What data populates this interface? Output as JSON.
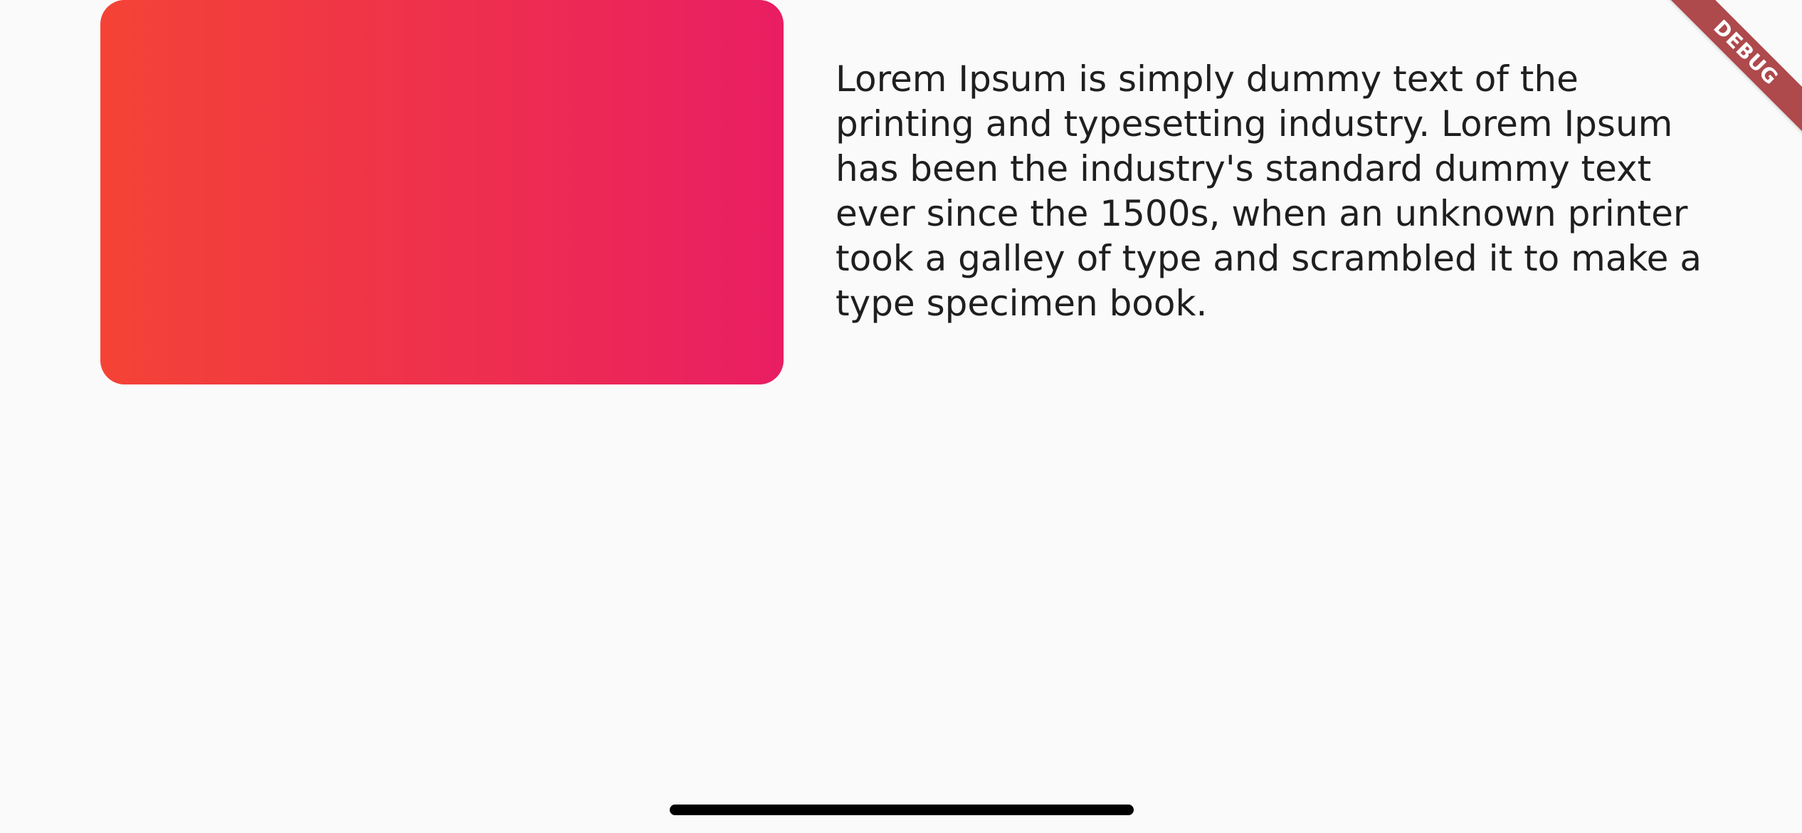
{
  "card": {
    "gradient_start": "#f44336",
    "gradient_end": "#e91e63"
  },
  "content": {
    "text": "Lorem Ipsum is simply dummy text of the printing and typesetting industry. Lorem Ipsum has been the industry's standard dummy text ever since the 1500s, when an unknown printer took a galley of type and scrambled it to make a type specimen book."
  },
  "debug_banner": {
    "label": "DEBUG",
    "color": "#a83a3e"
  },
  "system": {
    "home_indicator_color": "#000000"
  }
}
